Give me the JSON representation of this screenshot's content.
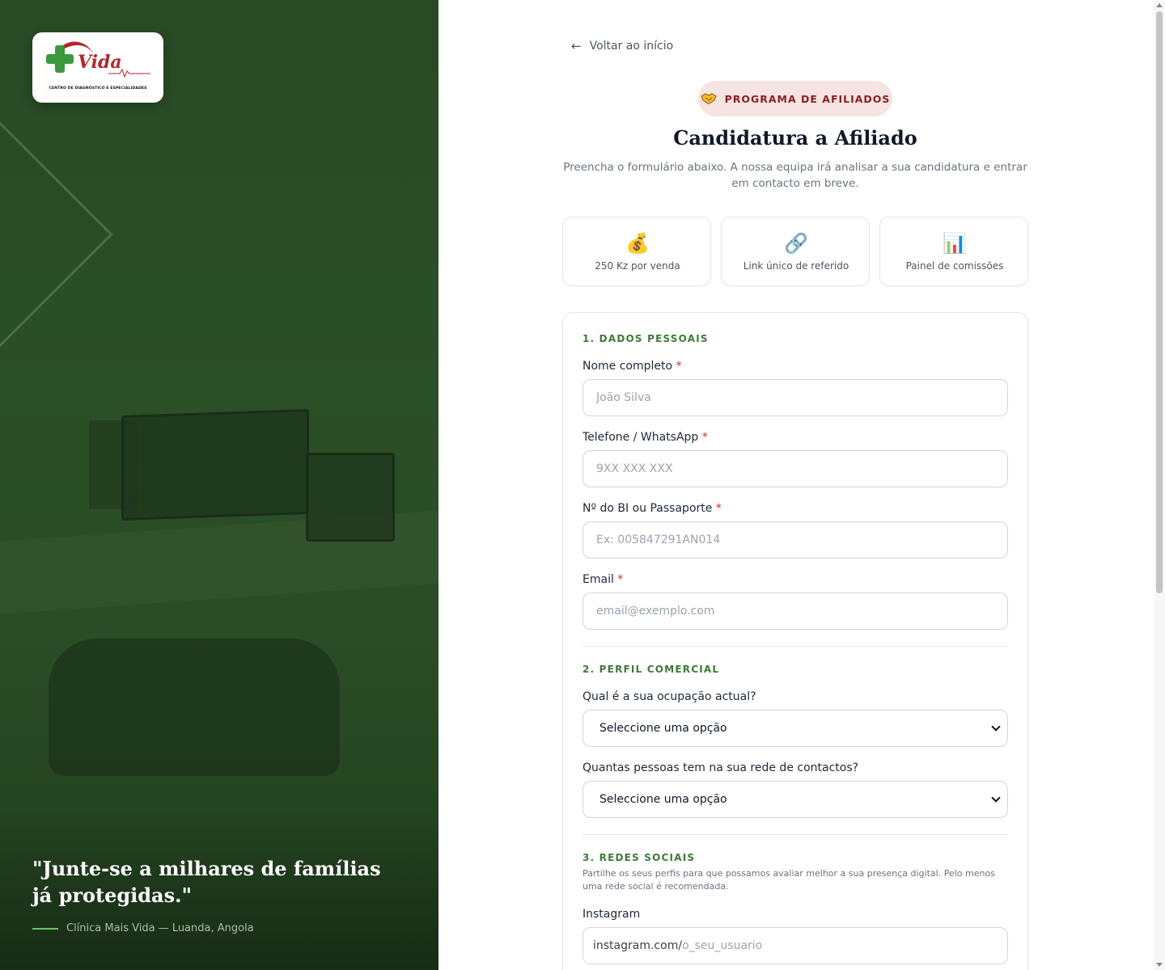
{
  "hero": {
    "logo_word": "Vida",
    "logo_tagline": "CENTRO DE DIAGNÓSTICO E ESPECIALIDADES",
    "quote": "\"Junte-se a milhares de famílias já protegidas.\"",
    "attribution": "Clínica Mais Vida — Luanda, Angola"
  },
  "nav": {
    "back_label": "Voltar ao início"
  },
  "badge": {
    "label": "PROGRAMA DE AFILIADOS",
    "icon": "handshake-icon"
  },
  "header": {
    "title": "Candidatura a Afiliado",
    "subtitle": "Preencha o formulário abaixo. A nossa equipa irá analisar a sua candidatura e entrar em contacto em breve."
  },
  "features": [
    {
      "icon": "money-bag-icon",
      "glyph": "💰",
      "label": "250 Kz por venda"
    },
    {
      "icon": "link-icon",
      "glyph": "🔗",
      "label": "Link único de referido"
    },
    {
      "icon": "bar-chart-icon",
      "glyph": "📊",
      "label": "Painel de comissões"
    }
  ],
  "form": {
    "section1": {
      "title": "1. DADOS PESSOAIS",
      "name_label": "Nome completo",
      "name_placeholder": "João Silva",
      "phone_label": "Telefone / WhatsApp",
      "phone_placeholder": "9XX XXX XXX",
      "id_label": "Nº do BI ou Passaporte",
      "id_placeholder": "Ex: 005847291AN014",
      "email_label": "Email",
      "email_placeholder": "email@exemplo.com",
      "required_mark": "*"
    },
    "section2": {
      "title": "2. PERFIL COMERCIAL",
      "occupation_label": "Qual é a sua ocupação actual?",
      "occupation_value": "Seleccione uma opção",
      "network_label": "Quantas pessoas tem na sua rede de contactos?",
      "network_value": "Seleccione uma opção"
    },
    "section3": {
      "title": "3. REDES SOCIAIS",
      "help": "Partilhe os seus perfis para que possamos avaliar melhor a sua presença digital. Pelo menos uma rede social é recomendada.",
      "instagram_label": "Instagram",
      "instagram_prefix": "instagram.com/",
      "instagram_placeholder": "o_seu_usuario"
    }
  },
  "colors": {
    "brand_green": "#3d7a36",
    "brand_red": "#8b1e1e",
    "badge_bg": "#f5e4e2",
    "hero_bg": "#2b4f27"
  }
}
